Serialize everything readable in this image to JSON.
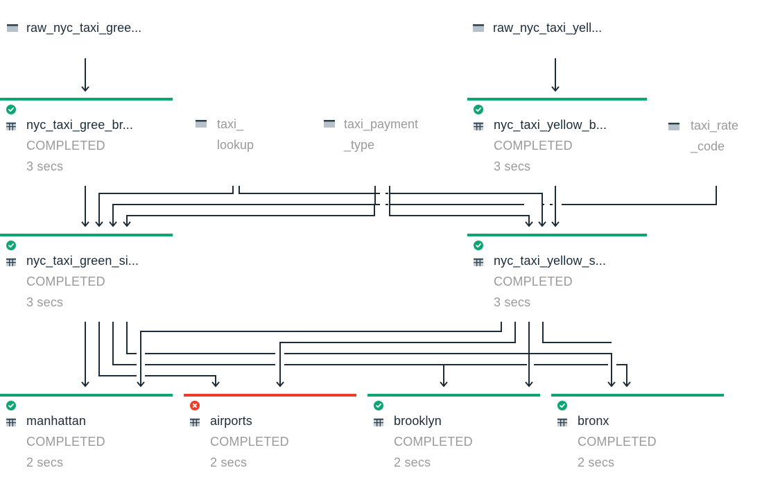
{
  "colors": {
    "success": "#0fa573",
    "error": "#ef3b2a",
    "edge": "#1c2c38",
    "text_primary": "#1c2c38",
    "text_muted": "#9a9a9a"
  },
  "sources": [
    {
      "id": "raw_green",
      "label": "raw_nyc_taxi_gree...",
      "icon": "source-table-icon"
    },
    {
      "id": "raw_yellow",
      "label": "raw_nyc_taxi_yell...",
      "icon": "source-table-icon"
    }
  ],
  "lookups": [
    {
      "id": "taxi_lookup",
      "label": "taxi_\nlookup",
      "icon": "source-table-icon"
    },
    {
      "id": "taxi_payment_type",
      "label": "taxi_payment\n_type",
      "icon": "source-table-icon"
    },
    {
      "id": "taxi_rate_code",
      "label": "taxi_rate\n_code",
      "icon": "source-table-icon"
    }
  ],
  "tasks": [
    {
      "id": "green_bronze",
      "label": "nyc_taxi_gree_br...",
      "status": "COMPLETED",
      "duration": "3 secs",
      "state": "success"
    },
    {
      "id": "yellow_bronze",
      "label": "nyc_taxi_yellow_b...",
      "status": "COMPLETED",
      "duration": "3 secs",
      "state": "success"
    },
    {
      "id": "green_silver",
      "label": "nyc_taxi_green_si...",
      "status": "COMPLETED",
      "duration": "3 secs",
      "state": "success"
    },
    {
      "id": "yellow_silver",
      "label": "nyc_taxi_yellow_s...",
      "status": "COMPLETED",
      "duration": "3 secs",
      "state": "success"
    },
    {
      "id": "manhattan",
      "label": "manhattan",
      "status": "COMPLETED",
      "duration": "2 secs",
      "state": "success"
    },
    {
      "id": "airports",
      "label": "airports",
      "status": "COMPLETED",
      "duration": "2 secs",
      "state": "error"
    },
    {
      "id": "brooklyn",
      "label": "brooklyn",
      "status": "COMPLETED",
      "duration": "2 secs",
      "state": "success"
    },
    {
      "id": "bronx",
      "label": "bronx",
      "status": "COMPLETED",
      "duration": "2 secs",
      "state": "success"
    }
  ],
  "edges": [
    {
      "from": "raw_green",
      "to": "green_bronze"
    },
    {
      "from": "raw_yellow",
      "to": "yellow_bronze"
    },
    {
      "from": "green_bronze",
      "to": "green_silver"
    },
    {
      "from": "taxi_lookup",
      "to": "green_silver"
    },
    {
      "from": "taxi_lookup",
      "to": "yellow_silver"
    },
    {
      "from": "taxi_payment_type",
      "to": "green_silver"
    },
    {
      "from": "taxi_payment_type",
      "to": "yellow_silver"
    },
    {
      "from": "yellow_bronze",
      "to": "yellow_silver"
    },
    {
      "from": "taxi_rate_code",
      "to": "yellow_silver"
    },
    {
      "from": "taxi_rate_code",
      "to": "green_silver"
    },
    {
      "from": "green_silver",
      "to": "manhattan"
    },
    {
      "from": "green_silver",
      "to": "airports"
    },
    {
      "from": "green_silver",
      "to": "brooklyn"
    },
    {
      "from": "green_silver",
      "to": "bronx"
    },
    {
      "from": "yellow_silver",
      "to": "manhattan"
    },
    {
      "from": "yellow_silver",
      "to": "airports"
    },
    {
      "from": "yellow_silver",
      "to": "brooklyn"
    },
    {
      "from": "yellow_silver",
      "to": "bronx"
    }
  ]
}
